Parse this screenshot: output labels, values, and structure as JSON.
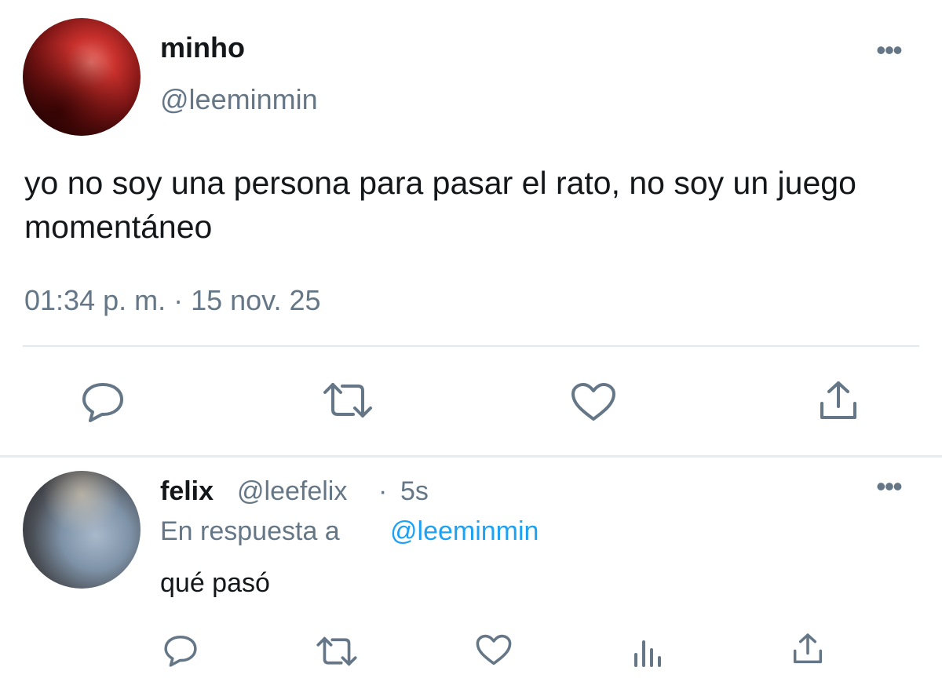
{
  "tweet": {
    "author_name": "minho",
    "author_handle": "@leeminmin",
    "text": "yo no soy una persona para pasar el rato, no soy un juego momentáneo",
    "timestamp": "01:34 p. m. · 15 nov. 25",
    "more_label": "•••",
    "actions": [
      "reply-icon",
      "retweet-icon",
      "like-icon",
      "share-icon"
    ]
  },
  "reply": {
    "author_name": "felix",
    "author_handle": "@leefelix",
    "separator": "·",
    "time": "5s",
    "reply_to_label": "En respuesta a",
    "reply_to_handle": "@leeminmin",
    "text": "qué pasó",
    "more_label": "•••",
    "actions": [
      "reply-icon",
      "retweet-icon",
      "like-icon",
      "analytics-icon",
      "share-icon"
    ]
  },
  "colors": {
    "text": "#14171a",
    "secondary": "#657786",
    "link": "#1da1f2",
    "divider": "#e1e8ed"
  }
}
